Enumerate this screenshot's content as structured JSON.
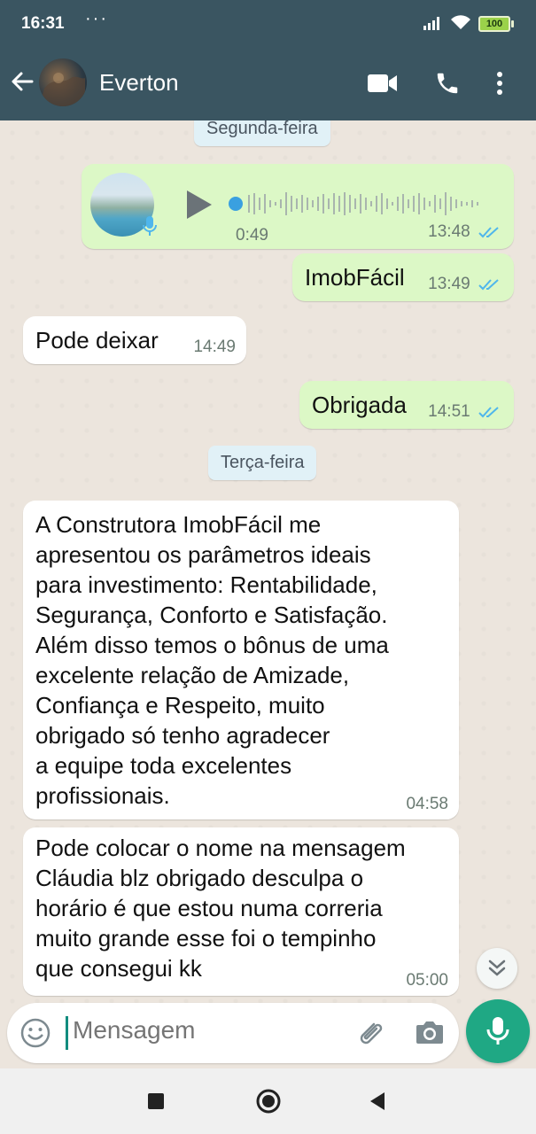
{
  "status_bar": {
    "time": "16:31",
    "dots": "···",
    "battery": "100"
  },
  "header": {
    "contact_name": "Everton"
  },
  "chat": {
    "date_1": "Segunda-feira",
    "voice_message": {
      "duration": "0:49",
      "time": "13:48"
    },
    "msg_imobfacil": {
      "text": "ImobFácil",
      "time": "13:49"
    },
    "msg_pode_deixar": {
      "text": "Pode deixar",
      "time": "14:49"
    },
    "msg_obrigada": {
      "text": "Obrigada",
      "time": "14:51"
    },
    "date_2": "Terça-feira",
    "msg_long_1": {
      "lines": [
        "A Construtora ImobFácil  me",
        "apresentou os parâmetros ideais",
        "para investimento: Rentabilidade,",
        "Segurança, Conforto e Satisfação.",
        "Além disso temos o bônus de uma",
        "excelente relação de Amizade,",
        "Confiança e Respeito, muito",
        "obrigado só tenho agradecer",
        "a equipe toda excelentes",
        "profissionais."
      ],
      "time": "04:58"
    },
    "msg_long_2": {
      "lines": [
        "Pode colocar o nome na mensagem",
        "Cláudia blz obrigado desculpa o",
        "horário é que estou numa correria",
        "muito grande esse foi o tempinho",
        "que consegui kk"
      ],
      "time": "05:00"
    }
  },
  "input": {
    "placeholder": "Mensagem"
  },
  "colors": {
    "header": "#3a5561",
    "outgoing_bubble": "#dcf8c6",
    "incoming_bubble": "#ffffff",
    "accent": "#1fa884",
    "read_ticks": "#4fb6ec"
  }
}
